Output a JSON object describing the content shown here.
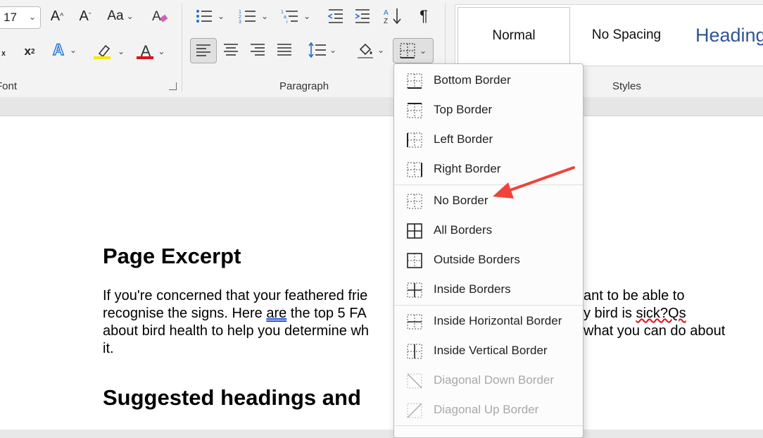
{
  "ribbon": {
    "font": {
      "size_value": "17",
      "grow_font": "A^",
      "shrink_font": "Aˇ",
      "change_case": "Aa",
      "superscript": "x²",
      "subscript": "ₓ",
      "label": "Font"
    },
    "paragraph": {
      "label": "Paragraph",
      "pilcrow": "¶"
    },
    "styles": {
      "label": "Styles",
      "items": [
        "Normal",
        "No Spacing",
        "Heading"
      ]
    },
    "colors": {
      "highlight": "#f5e800",
      "font_color": "#e0101a",
      "text_effects": "#1f6fd6"
    }
  },
  "document": {
    "heading1": "Page Excerpt",
    "paragraph_lines": [
      "If you're concerned that your feathered frie",
      "recognise the signs. Here are the top 5 FA",
      "about bird health to help you determine wh",
      "it."
    ],
    "paragraph_right_lines": [
      "ant to be able to",
      "y bird is sick?Qs",
      "what you can do about"
    ],
    "heading2": "Suggested headings and"
  },
  "borders_menu": {
    "items": [
      {
        "label": "Bottom Border",
        "icon": "bottom-border-icon",
        "enabled": true
      },
      {
        "label": "Top Border",
        "icon": "top-border-icon",
        "enabled": true
      },
      {
        "label": "Left Border",
        "icon": "left-border-icon",
        "enabled": true
      },
      {
        "label": "Right Border",
        "icon": "right-border-icon",
        "enabled": true
      },
      {
        "label": "No Border",
        "icon": "no-border-icon",
        "enabled": true
      },
      {
        "label": "All Borders",
        "icon": "all-borders-icon",
        "enabled": true
      },
      {
        "label": "Outside Borders",
        "icon": "outside-borders-icon",
        "enabled": true
      },
      {
        "label": "Inside Borders",
        "icon": "inside-borders-icon",
        "enabled": true
      },
      {
        "label": "Inside Horizontal Border",
        "icon": "inside-horizontal-border-icon",
        "enabled": true
      },
      {
        "label": "Inside Vertical Border",
        "icon": "inside-vertical-border-icon",
        "enabled": true
      },
      {
        "label": "Diagonal Down Border",
        "icon": "diagonal-down-border-icon",
        "enabled": false
      },
      {
        "label": "Diagonal Up Border",
        "icon": "diagonal-up-border-icon",
        "enabled": false
      }
    ]
  },
  "annotation": {
    "arrow_color": "#f0433a"
  }
}
